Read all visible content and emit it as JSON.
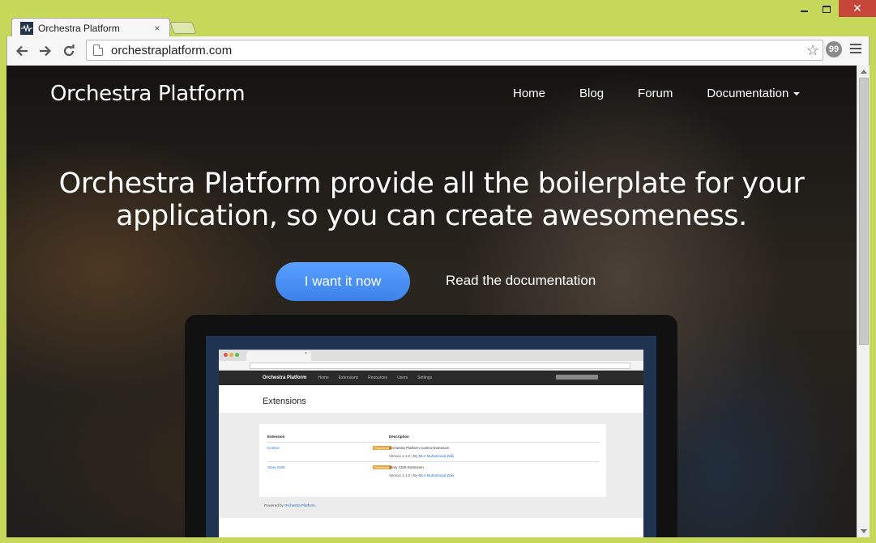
{
  "browser": {
    "tab_title": "Orchestra Platform",
    "tab_close": "×",
    "url": "orchestraplatform.com",
    "window_close": "✕"
  },
  "site": {
    "brand": "Orchestra Platform",
    "nav": [
      "Home",
      "Blog",
      "Forum",
      "Documentation"
    ],
    "headline": "Orchestra Platform provide all the boilerplate for your application, so you can create awesomeness.",
    "cta_primary": "I want it now",
    "cta_secondary": "Read the documentation",
    "accent": "#4a90f5"
  },
  "mockup": {
    "brand": "Orchestra Platform",
    "nav": [
      "Home",
      "Extensions",
      "Resources",
      "Users",
      "Settings"
    ],
    "page_title": "Extensions",
    "table_headers": [
      "Extension",
      "Description"
    ],
    "rows": [
      {
        "name": "Control",
        "badge": "Deactivate",
        "desc": "Orchestra Platform Control Extension",
        "meta_prefix": "Version 2.1.0 | By ",
        "meta_author": "Mior Muhammad Zaki"
      },
      {
        "name": "Story CMS",
        "badge": "Deactivate",
        "desc": "Story CMS Extension",
        "meta_prefix": "Version 2.1.0 | By ",
        "meta_author": "Mior Muhammad Zaki"
      }
    ],
    "footer_prefix": "Powered by ",
    "footer_link": "Orchestra Platform."
  }
}
